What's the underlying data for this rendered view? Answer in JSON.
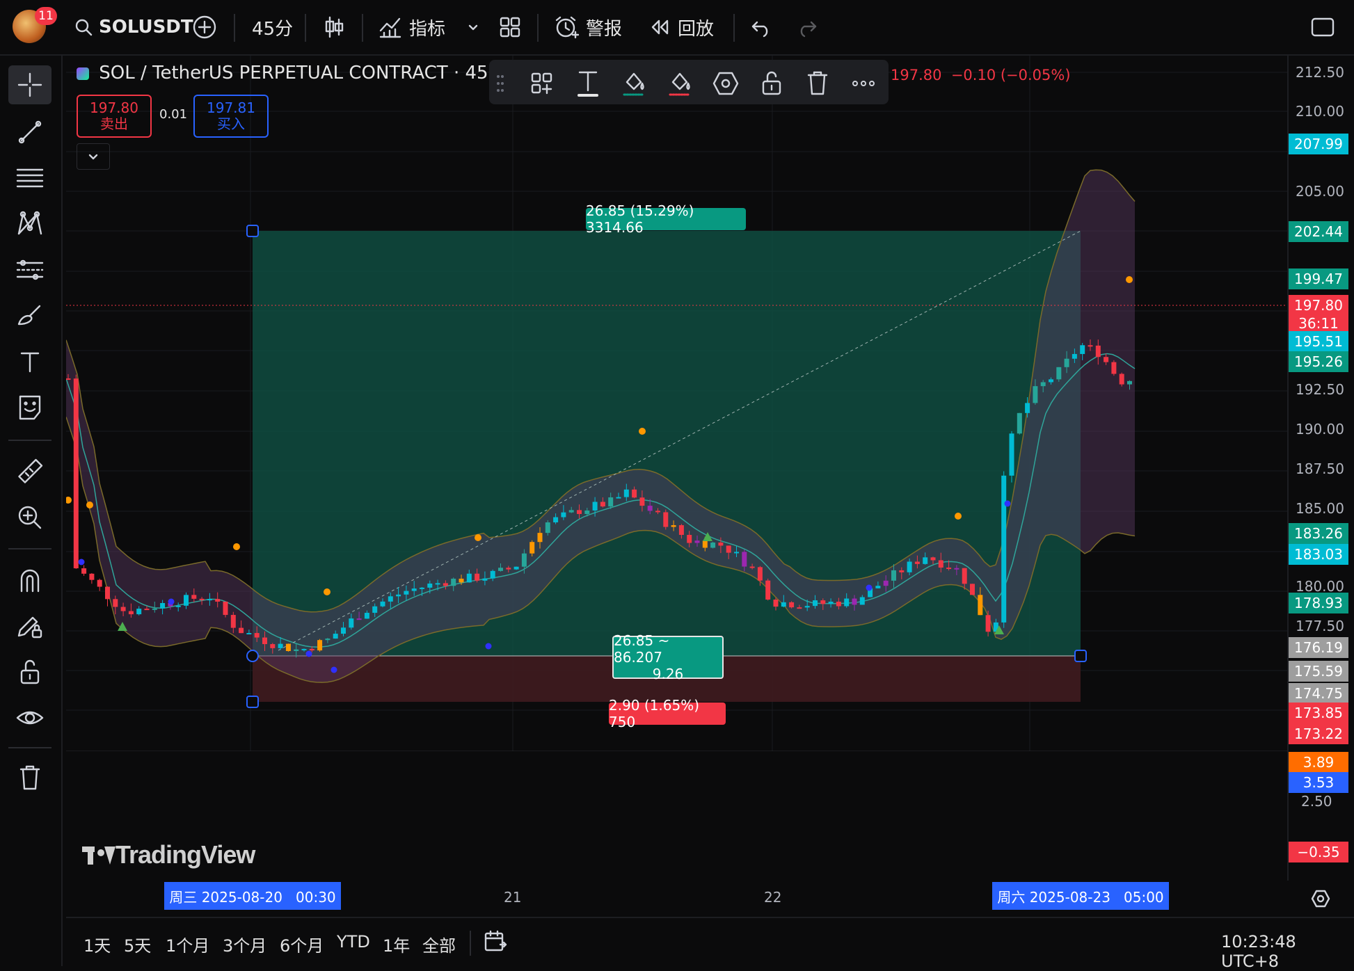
{
  "topbar": {
    "notifications": "11",
    "symbol": "SOLUSDT",
    "interval": "45分",
    "indicators": "指标",
    "alert": "警报",
    "replay": "回放"
  },
  "legend": {
    "title": "SOL / TetherUS PERPETUAL CONTRACT · 45 ·",
    "ohlc_tail": "197.80  −0.10 (−0.05%)",
    "sell_price": "197.80",
    "sell_label": "卖出",
    "spread": "0.01",
    "buy_price": "197.81",
    "buy_label": "买入"
  },
  "position_tool": {
    "target_label": "26.85 (15.29%) 3314.66",
    "center_line1": "26.85 ~ 86.207",
    "center_line2": "9.26",
    "stop_label": "2.90 (1.65%) 750"
  },
  "price_axis": {
    "ticks": [
      "212.50",
      "210.00",
      "205.00",
      "192.50",
      "190.00",
      "187.50",
      "185.00",
      "180.00",
      "177.50"
    ],
    "badges": [
      {
        "text": "207.99",
        "color": "#00bcd4"
      },
      {
        "text": "202.44",
        "color": "#089981"
      },
      {
        "text": "199.47",
        "color": "#089981"
      },
      {
        "text": "197.80",
        "color": "#f23645"
      },
      {
        "text": "36:11",
        "color": "#f23645"
      },
      {
        "text": "195.51",
        "color": "#00bcd4"
      },
      {
        "text": "195.26",
        "color": "#089981"
      },
      {
        "text": "183.26",
        "color": "#089981"
      },
      {
        "text": "183.03",
        "color": "#00bcd4"
      },
      {
        "text": "178.93",
        "color": "#089981"
      },
      {
        "text": "176.19",
        "color": "#9e9e9e"
      },
      {
        "text": "175.59",
        "color": "#9e9e9e"
      },
      {
        "text": "174.75",
        "color": "#9e9e9e"
      },
      {
        "text": "173.85",
        "color": "#f23645"
      },
      {
        "text": "173.22",
        "color": "#f23645"
      }
    ],
    "macd_ticks": [
      "2.50"
    ],
    "macd_badges": [
      {
        "text": "3.89",
        "color": "#ff6d00"
      },
      {
        "text": "3.53",
        "color": "#2962ff"
      },
      {
        "text": "−0.35",
        "color": "#f23645"
      }
    ]
  },
  "time_axis": {
    "start_label": "周三 2025-08-20   00:30",
    "tick_21": "21",
    "tick_22": "22",
    "end_label": "周六 2025-08-23   05:00"
  },
  "bottombar": {
    "ranges": [
      "1天",
      "5天",
      "1个月",
      "3个月",
      "6个月",
      "YTD",
      "1年",
      "全部"
    ],
    "clock": "10:23:48 UTC+8"
  },
  "watermark": "TradingView",
  "chart_data": {
    "type": "candlestick",
    "symbol": "SOLUSDT",
    "timeframe": "45分",
    "ylim": [
      170,
      213
    ],
    "last_price": 197.8,
    "position": {
      "entry": 176.2,
      "target": 203.05,
      "stop": 173.3
    },
    "indicators": [
      "Bollinger Bands",
      "MACD"
    ]
  }
}
